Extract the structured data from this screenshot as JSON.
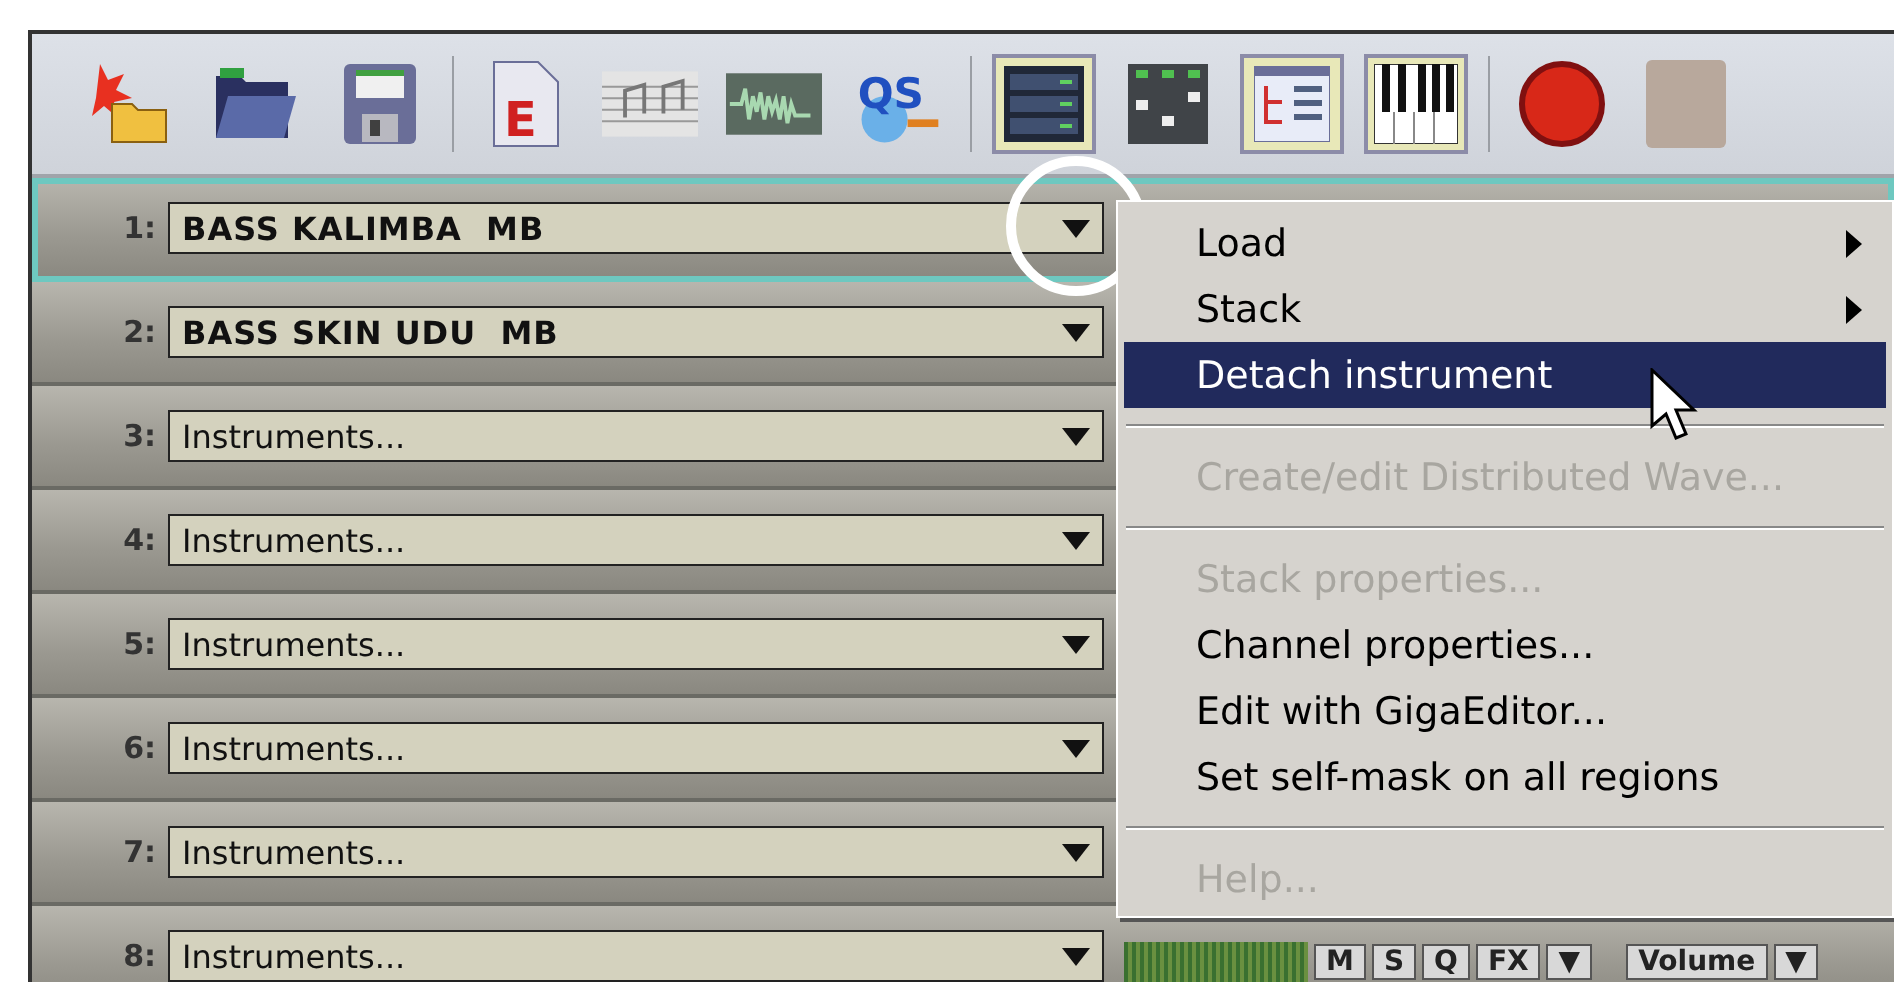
{
  "toolbar": {
    "groups": [
      [
        {
          "kind": "new"
        },
        {
          "kind": "open"
        },
        {
          "kind": "save"
        }
      ],
      [
        {
          "kind": "edoc",
          "label": "E"
        },
        {
          "kind": "notes"
        },
        {
          "kind": "wave"
        },
        {
          "kind": "qs",
          "label": "QS"
        }
      ],
      [
        {
          "kind": "rack",
          "selected": true
        },
        {
          "kind": "mixer",
          "selected": false
        },
        {
          "kind": "tree",
          "selected": true
        },
        {
          "kind": "piano",
          "selected": true
        }
      ],
      [
        {
          "kind": "record"
        },
        {
          "kind": "stop"
        }
      ]
    ]
  },
  "channels": [
    {
      "number": "1:",
      "instrument": "BASS KALIMBA  MB",
      "selected": true
    },
    {
      "number": "2:",
      "instrument": "BASS SKIN UDU  MB",
      "selected": false
    },
    {
      "number": "3:",
      "instrument": "Instruments...",
      "selected": false
    },
    {
      "number": "4:",
      "instrument": "Instruments...",
      "selected": false
    },
    {
      "number": "5:",
      "instrument": "Instruments...",
      "selected": false
    },
    {
      "number": "6:",
      "instrument": "Instruments...",
      "selected": false
    },
    {
      "number": "7:",
      "instrument": "Instruments...",
      "selected": false
    },
    {
      "number": "8:",
      "instrument": "Instruments...",
      "selected": false,
      "controls": {
        "buttons": [
          "M",
          "S",
          "Q",
          "FX",
          "▼"
        ],
        "volume": "Volume",
        "volume_arrow": "▼"
      }
    }
  ],
  "context_menu": {
    "items": [
      {
        "kind": "item",
        "label": "Load",
        "submenu": true,
        "disabled": false,
        "selected": false
      },
      {
        "kind": "item",
        "label": "Stack",
        "submenu": true,
        "disabled": false,
        "selected": false
      },
      {
        "kind": "item",
        "label": "Detach instrument",
        "submenu": false,
        "disabled": false,
        "selected": true
      },
      {
        "kind": "separator"
      },
      {
        "kind": "item",
        "label": "Create/edit Distributed Wave...",
        "submenu": false,
        "disabled": true,
        "selected": false
      },
      {
        "kind": "separator"
      },
      {
        "kind": "item",
        "label": "Stack properties...",
        "submenu": false,
        "disabled": true,
        "selected": false
      },
      {
        "kind": "item",
        "label": "Channel properties...",
        "submenu": false,
        "disabled": false,
        "selected": false
      },
      {
        "kind": "item",
        "label": "Edit with GigaEditor...",
        "submenu": false,
        "disabled": false,
        "selected": false
      },
      {
        "kind": "item",
        "label": "Set self-mask on all regions",
        "submenu": false,
        "disabled": false,
        "selected": false
      },
      {
        "kind": "separator"
      },
      {
        "kind": "item",
        "label": "Help...",
        "submenu": false,
        "disabled": true,
        "selected": false
      }
    ]
  }
}
